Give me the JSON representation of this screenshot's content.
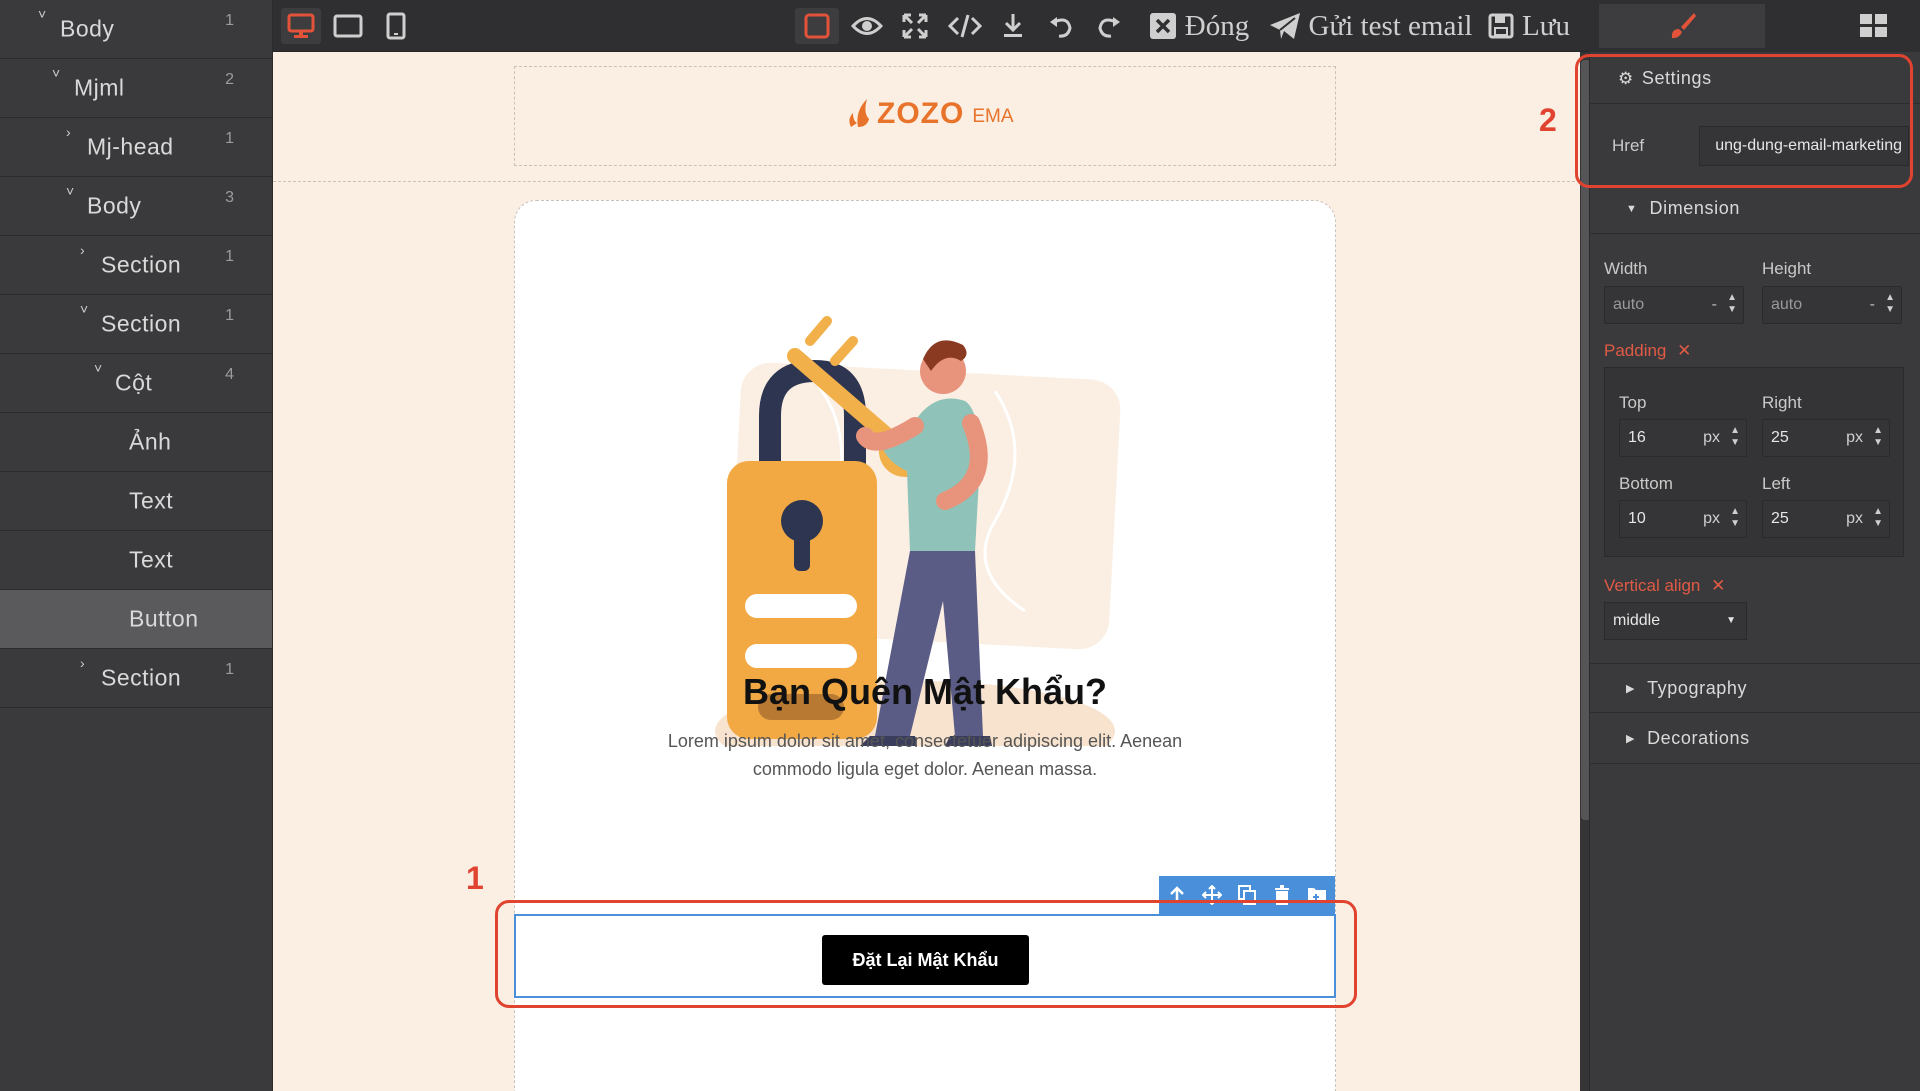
{
  "layers": [
    {
      "label": "Body",
      "count": "1",
      "caret": "˅"
    },
    {
      "label": "Mjml",
      "count": "2",
      "caret": "˅"
    },
    {
      "label": "Mj-head",
      "count": "1",
      "caret": "›"
    },
    {
      "label": "Body",
      "count": "3",
      "caret": "˅"
    },
    {
      "label": "Section",
      "count": "1",
      "caret": "›"
    },
    {
      "label": "Section",
      "count": "1",
      "caret": "˅"
    },
    {
      "label": "Cột",
      "count": "4",
      "caret": "˅"
    },
    {
      "label": "Ảnh",
      "count": "",
      "caret": ""
    },
    {
      "label": "Text",
      "count": "",
      "caret": ""
    },
    {
      "label": "Text",
      "count": "",
      "caret": ""
    },
    {
      "label": "Button",
      "count": "",
      "caret": ""
    },
    {
      "label": "Section",
      "count": "1",
      "caret": "›"
    }
  ],
  "toolbar": {
    "close_label": "Đóng",
    "send_test_label": "Gửi test email",
    "save_label": "Lưu"
  },
  "email": {
    "logo_text": "ZOZO",
    "logo_suffix": "EMA",
    "title": "Bạn Quên Mật Khẩu?",
    "body_line1": "Lorem ipsum dolor sit amet, consectetuer adipiscing elit. Aenean",
    "body_line2": "commodo ligula eget dolor. Aenean massa.",
    "button_label": "Đặt Lại Mật Khẩu"
  },
  "settings": {
    "header": "Settings",
    "href_label": "Href",
    "href_value": "ung-dung-email-marketing"
  },
  "dimension": {
    "header": "Dimension",
    "width_label": "Width",
    "width_value": "auto",
    "height_label": "Height",
    "height_value": "auto",
    "unit_placeholder": "-",
    "padding_label": "Padding",
    "top_label": "Top",
    "top_value": "16",
    "right_label": "Right",
    "right_value": "25",
    "bottom_label": "Bottom",
    "bottom_value": "10",
    "left_label": "Left",
    "left_value": "25",
    "unit": "px",
    "valign_label": "Vertical align",
    "valign_value": "middle"
  },
  "sections": {
    "typography": "Typography",
    "decorations": "Decorations"
  },
  "annotations": {
    "one": "1",
    "two": "2"
  },
  "colors": {
    "accent_red": "#e0432f",
    "selection_blue": "#4a8fd9",
    "canvas_bg": "#fbeee2",
    "brand_orange": "#e8732a"
  }
}
